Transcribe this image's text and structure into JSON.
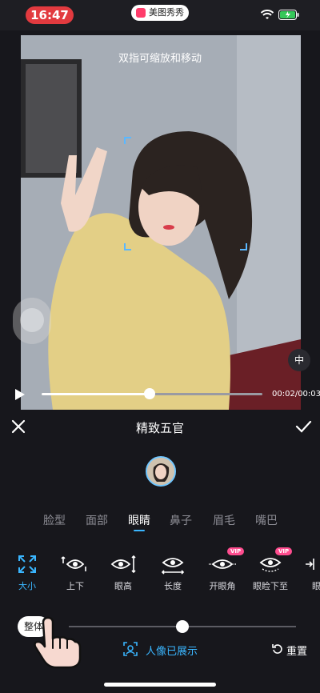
{
  "status_bar": {
    "time": "16:47",
    "app_name": "美图秀秀"
  },
  "preview": {
    "hint": "双指可缩放和移动",
    "compare_label": "中",
    "video_time": "00:02/00:03",
    "progress": 0.49
  },
  "header": {
    "title": "精致五官"
  },
  "tabs": [
    {
      "label": "脸型",
      "active": false
    },
    {
      "label": "面部",
      "active": false
    },
    {
      "label": "眼睛",
      "active": true
    },
    {
      "label": "鼻子",
      "active": false
    },
    {
      "label": "眉毛",
      "active": false
    },
    {
      "label": "嘴巴",
      "active": false
    }
  ],
  "tools": [
    {
      "label": "大小",
      "icon": "expand-icon",
      "vip": false,
      "active": true
    },
    {
      "label": "上下",
      "icon": "eye-updown-icon",
      "vip": false,
      "active": false
    },
    {
      "label": "眼高",
      "icon": "eye-height-icon",
      "vip": false,
      "active": false
    },
    {
      "label": "长度",
      "icon": "eye-length-icon",
      "vip": false,
      "active": false
    },
    {
      "label": "开眼角",
      "icon": "eye-corner-icon",
      "vip": true,
      "active": false
    },
    {
      "label": "眼睑下至",
      "icon": "eyelid-icon",
      "vip": true,
      "active": false
    },
    {
      "label": "眼",
      "icon": "eye-partial-icon",
      "vip": false,
      "active": false
    }
  ],
  "vip_badge": "VIP",
  "slider": {
    "pill_label": "整体",
    "value": 0.5
  },
  "footer": {
    "portrait_label": "人像已展示",
    "reset_label": "重置"
  },
  "colors": {
    "accent": "#3ab6ff",
    "background": "#17171c",
    "status_red": "#e23a3f",
    "vip_pink": "#ff4d8f"
  }
}
